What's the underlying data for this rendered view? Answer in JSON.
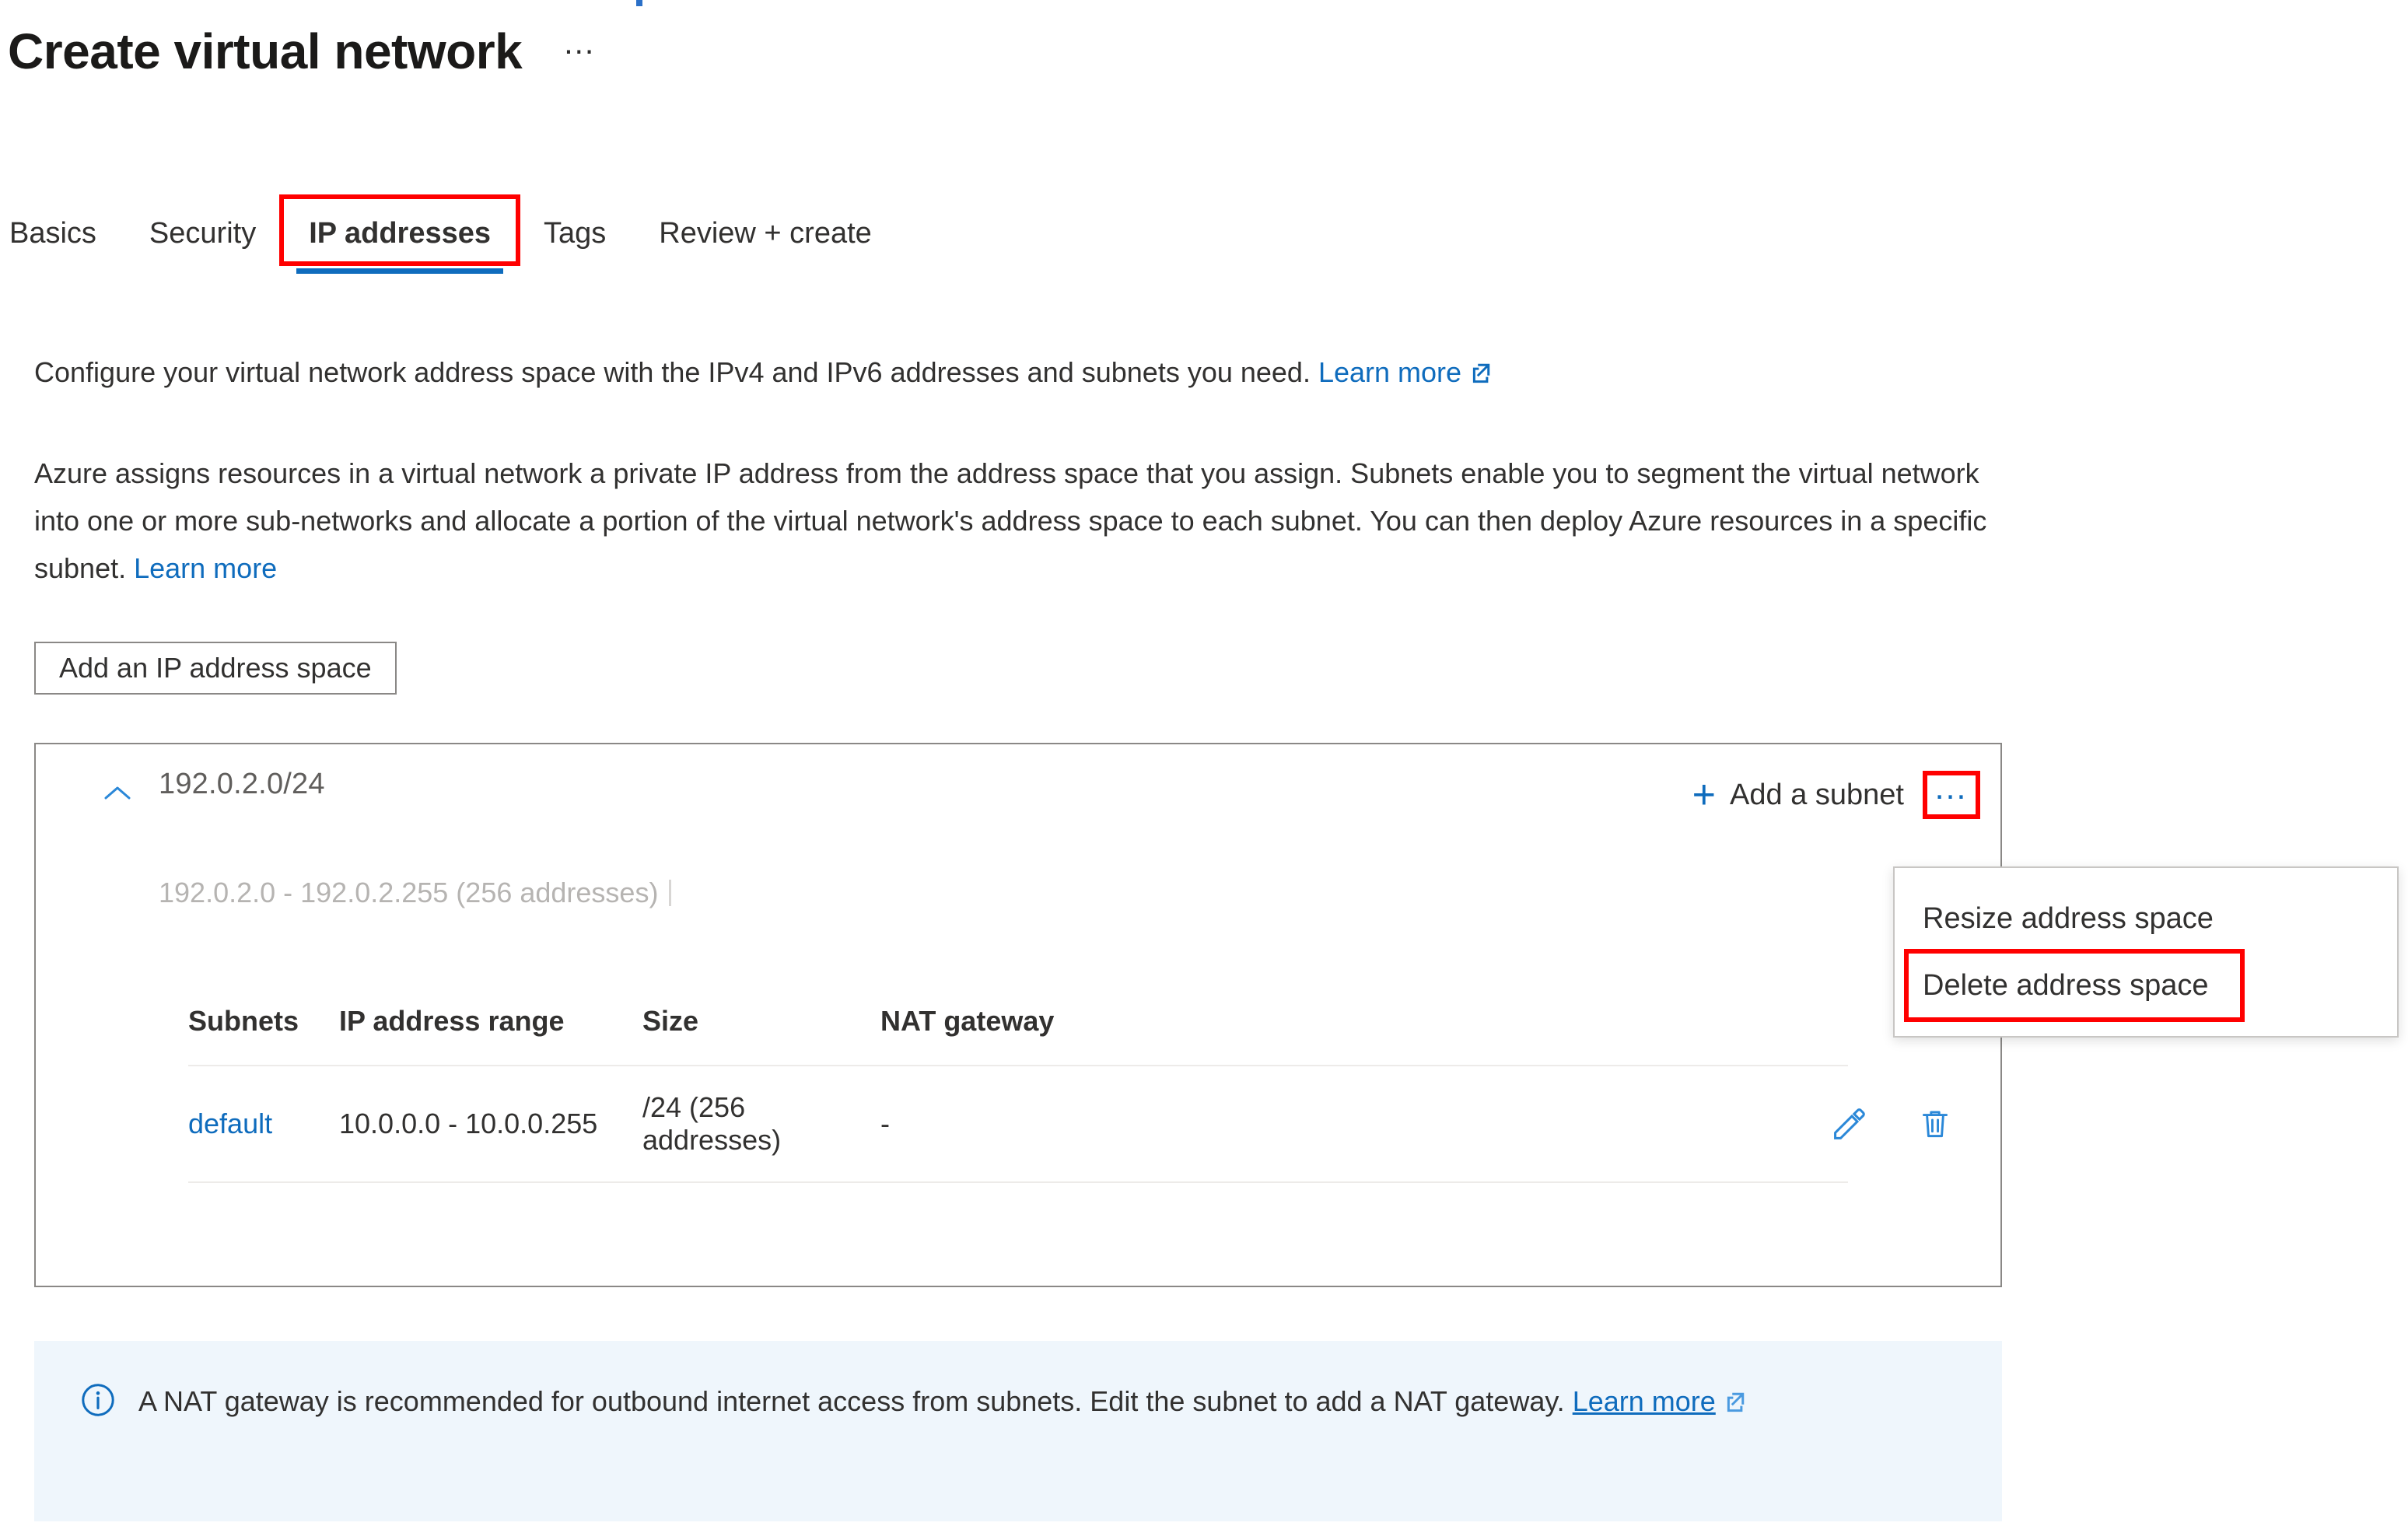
{
  "page": {
    "title": "Create virtual network",
    "title_more_label": "…"
  },
  "tabs": [
    {
      "label": "Basics",
      "selected": false
    },
    {
      "label": "Security",
      "selected": false
    },
    {
      "label": "IP addresses",
      "selected": true
    },
    {
      "label": "Tags",
      "selected": false
    },
    {
      "label": "Review + create",
      "selected": false
    }
  ],
  "descriptions": {
    "para1_text": "Configure your virtual network address space with the IPv4 and IPv6 addresses and subnets you need.",
    "para1_link": "Learn more",
    "para2_text": "Azure assigns resources in a virtual network a private IP address from the address space that you assign. Subnets enable you to segment the virtual network into one or more sub-networks and allocate a portion of the virtual network's address space to each subnet. You can then deploy Azure resources in a specific subnet.",
    "para2_link": "Learn more"
  },
  "toolbar": {
    "add_address_space_label": "Add an IP address space"
  },
  "address_space": {
    "cidr": "192.0.2.0/24",
    "range_text": "192.0.2.0 - 192.0.2.255 (256 addresses)",
    "add_subnet_label": "Add a subnet",
    "more_label": "…"
  },
  "context_menu": {
    "items": [
      {
        "label": "Resize address space",
        "highlighted": false
      },
      {
        "label": "Delete address space",
        "highlighted": true
      }
    ]
  },
  "subnets_table": {
    "columns": [
      "Subnets",
      "IP address range",
      "Size",
      "NAT gateway"
    ],
    "rows": [
      {
        "name": "default",
        "ip_range": "10.0.0.0 - 10.0.0.255",
        "size": "/24 (256 addresses)",
        "nat_gateway": "-"
      }
    ]
  },
  "info_banner": {
    "text": "A NAT gateway is recommended for outbound internet access from subnets. Edit the subnet to add a NAT gateway.",
    "link": "Learn more"
  },
  "colors": {
    "accent_blue": "#0f6cbd",
    "highlight_red": "#ff0000",
    "banner_bg": "#eff6fc",
    "muted_text": "#b6b4b2"
  }
}
